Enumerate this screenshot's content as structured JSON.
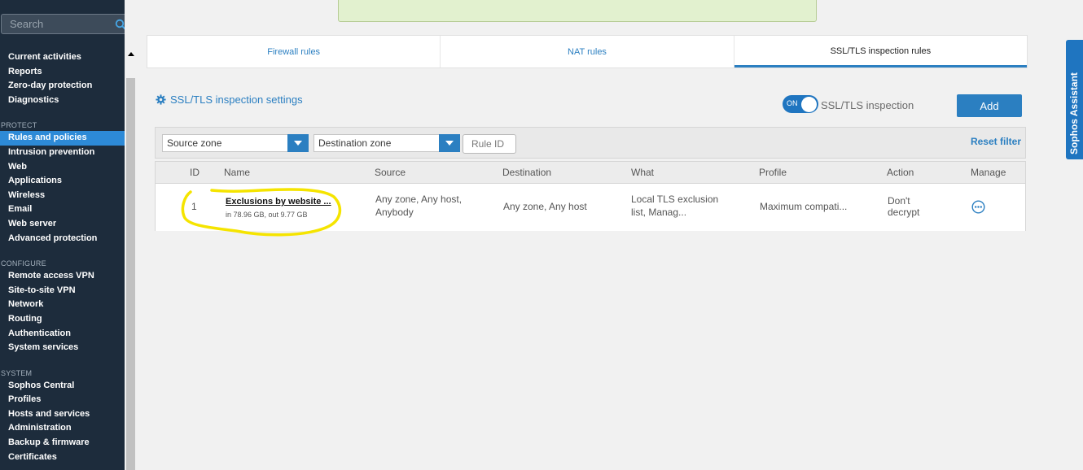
{
  "sidebar": {
    "search_placeholder": "Search",
    "items": [
      {
        "label": "Current activities"
      },
      {
        "label": "Reports"
      },
      {
        "label": "Zero-day protection"
      },
      {
        "label": "Diagnostics"
      }
    ],
    "protect_label": "PROTECT",
    "protect_items": [
      {
        "label": "Rules and policies",
        "active": true
      },
      {
        "label": "Intrusion prevention"
      },
      {
        "label": "Web"
      },
      {
        "label": "Applications"
      },
      {
        "label": "Wireless"
      },
      {
        "label": "Email"
      },
      {
        "label": "Web server"
      },
      {
        "label": "Advanced protection"
      }
    ],
    "configure_label": "CONFIGURE",
    "configure_items": [
      {
        "label": "Remote access VPN"
      },
      {
        "label": "Site-to-site VPN"
      },
      {
        "label": "Network"
      },
      {
        "label": "Routing"
      },
      {
        "label": "Authentication"
      },
      {
        "label": "System services"
      }
    ],
    "system_label": "SYSTEM",
    "system_items": [
      {
        "label": "Sophos Central"
      },
      {
        "label": "Profiles"
      },
      {
        "label": "Hosts and services"
      },
      {
        "label": "Administration"
      },
      {
        "label": "Backup & firmware"
      },
      {
        "label": "Certificates"
      }
    ]
  },
  "tabs": [
    {
      "label": "Firewall rules"
    },
    {
      "label": "NAT rules"
    },
    {
      "label": "SSL/TLS inspection rules",
      "active": true
    }
  ],
  "settings": {
    "link_label": "SSL/TLS inspection settings",
    "toggle_state": "ON",
    "toggle_label": "SSL/TLS inspection",
    "add_label": "Add"
  },
  "filters": {
    "source_zone": "Source zone",
    "destination_zone": "Destination zone",
    "rule_id_placeholder": "Rule ID",
    "reset_label": "Reset filter"
  },
  "table": {
    "headers": {
      "id": "ID",
      "name": "Name",
      "source": "Source",
      "destination": "Destination",
      "what": "What",
      "profile": "Profile",
      "action": "Action",
      "manage": "Manage"
    },
    "rows": [
      {
        "id": "1",
        "name": "Exclusions by website ...",
        "traffic": "in 78.96 GB, out 9.77 GB",
        "source_line1": "Any zone, Any host,",
        "source_line2": "Anybody",
        "destination": "Any zone, Any host",
        "what_line1": "Local TLS exclusion",
        "what_line2": "list, Manag...",
        "profile": "Maximum compati...",
        "action_line1": "Don't",
        "action_line2": "decrypt"
      }
    ]
  },
  "assistant": {
    "label": "Sophos Assistant"
  },
  "colors": {
    "sidebar_bg": "#1d2c3c",
    "accent": "#2b7fc1",
    "active_nav": "#2d8ad7",
    "banner_bg": "#e2f1cf",
    "highlight": "#f5e400"
  }
}
